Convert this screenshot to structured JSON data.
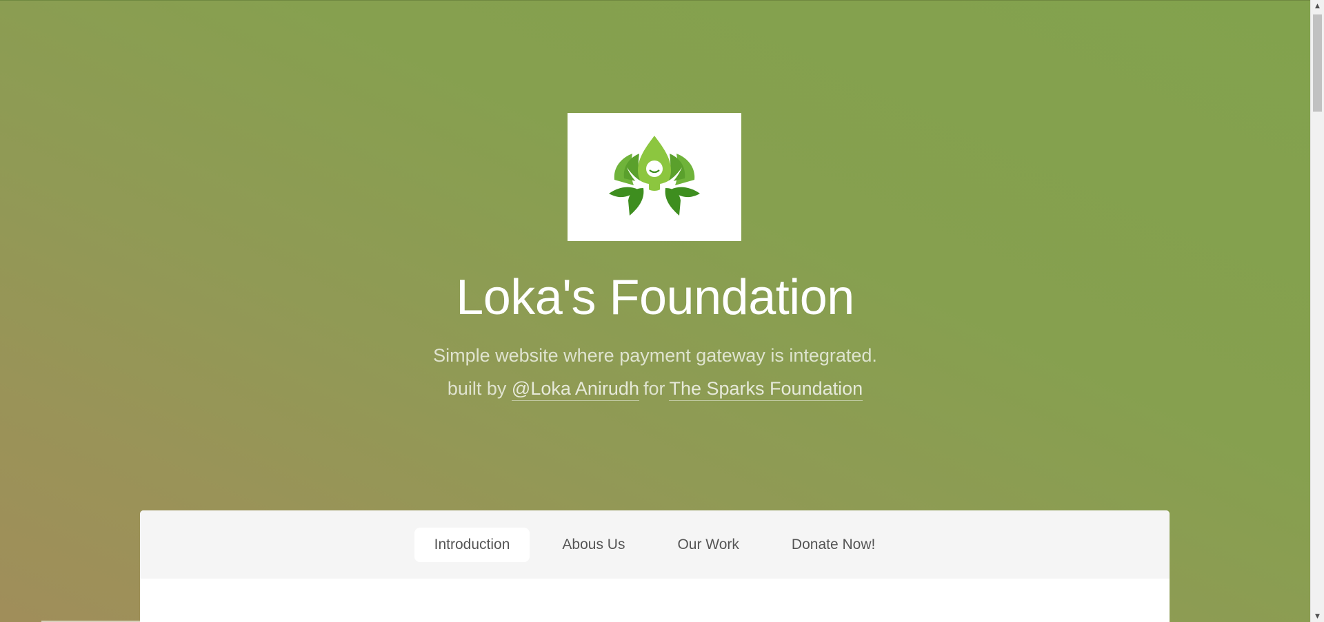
{
  "hero": {
    "logo_icon": "lotus-person-logo",
    "title": "Loka's Foundation",
    "tagline": "Simple website where payment gateway is integrated.",
    "credits": {
      "prefix": "built by",
      "author_link": "@Loka Anirudh",
      "middle": "for",
      "org_link": "The Sparks Foundation"
    }
  },
  "tabs": [
    {
      "label": "Introduction",
      "active": true
    },
    {
      "label": "Abous Us",
      "active": false
    },
    {
      "label": "Our Work",
      "active": false
    },
    {
      "label": "Donate Now!",
      "active": false
    }
  ],
  "colors": {
    "background_top": "#82a24d",
    "background_bottom_left": "#a08e5a",
    "logo_green_light": "#8cc63f",
    "logo_green_dark": "#3e8e1f"
  }
}
